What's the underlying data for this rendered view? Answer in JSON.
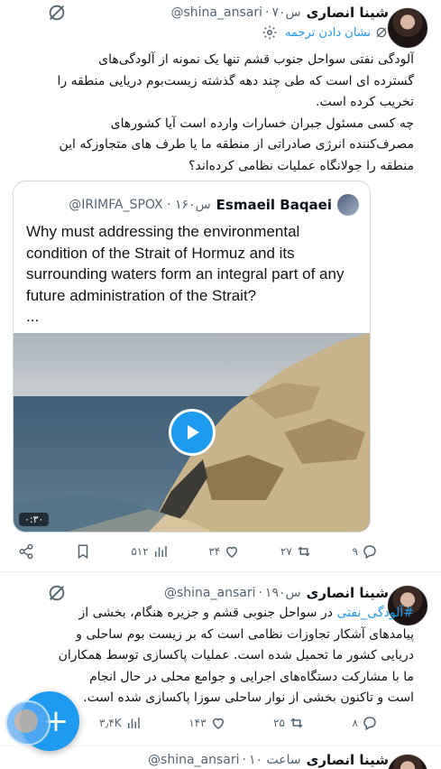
{
  "tweets": [
    {
      "name": "شینا انصاری",
      "handle": "@shina_ansari",
      "time": "۷۰س",
      "translate": "نشان دادن ترجمه",
      "text": "آلودگی نفتی سواحل جنوب قشم تنها یک نمونه از آلودگی‌های\nگسترده ای است که طی چند دهه گذشته زیست‌بوم دریایی منطقه را\nتخریب کرده است.\nچه کسی مسئول جبران خسارات وارده است آیا کشورهای\nمصرف‌کننده انرژی صادراتی از منطقه ما یا طرف های متجاوزکه این\nمنطقه را جولانگاه عملیات نظامی کرده‌اند؟",
      "quote": {
        "name": "Esmaeil Baqaei",
        "handle": "@IRIMFA_SPOX",
        "time": "۱۶۰س",
        "text": "Why must addressing the environmental condition of the Strait of Hormuz and its surrounding waters form an integral part of any future administration of the Strait?",
        "ellipsis": "...",
        "duration": "۰:۳۰"
      },
      "actions": {
        "views": "۵۱۲",
        "likes": "۳۴",
        "retweets": "۲۷",
        "replies": "۹"
      }
    },
    {
      "name": "شینا انصاری",
      "handle": "@shina_ansari",
      "time": "۱۹۰س",
      "hashtag": "#آلودگی_نفتی",
      "text": " در سواحل جنوبی قشم و جزیره هنگام، بخشی از\nپیامدهای آشکار تجاوزات نظامی است که بر زیست بوم ساحلی و\nدریایی کشور ما تحمیل شده است. عملیات پاکسازی توسط همکاران\nما با مشارکت دستگاه‌های اجرایی و جوامع محلی در حال انجام\nاست و تاکنون بخشی از نوار ساحلی سوزا پاکسازی شده است.",
      "actions": {
        "views": "۳٫۴K",
        "likes": "۱۴۳",
        "retweets": "۲۵",
        "replies": "۸"
      }
    },
    {
      "name": "شینا انصاری",
      "handle": "@shina_ansari",
      "time": "۱۰ ساعت"
    }
  ],
  "colors": {
    "accent": "#1d9bf0",
    "muted": "#536471",
    "text": "#0f1419"
  },
  "icons": [
    "grok-icon",
    "gear-icon",
    "translate-icon",
    "share-icon",
    "bookmark-icon",
    "views-icon",
    "like-icon",
    "retweet-icon",
    "reply-icon",
    "play-icon",
    "compose-icon"
  ]
}
